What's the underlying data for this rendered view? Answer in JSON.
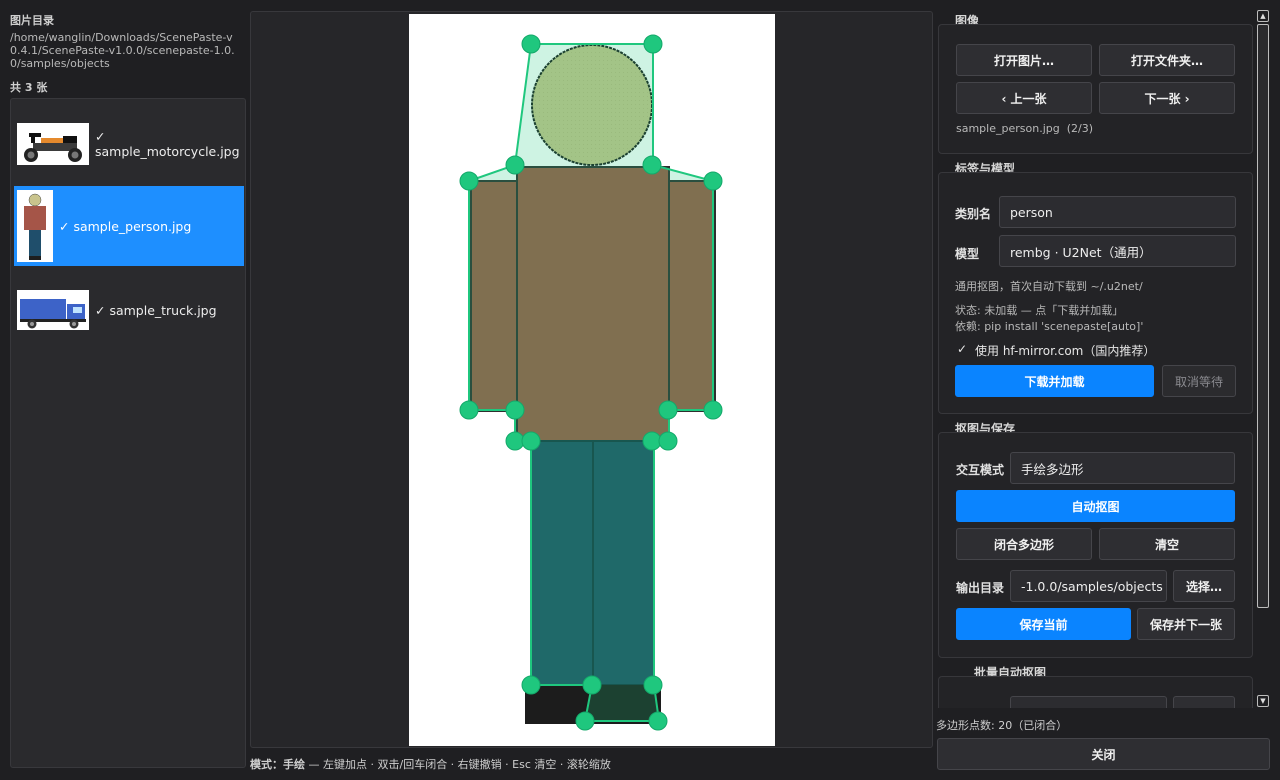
{
  "left": {
    "title": "图片目录",
    "path": "/home/wanglin/Downloads/ScenePaste-v0.4.1/ScenePaste-v1.0.0/scenepaste-1.0.0/samples/objects",
    "count": "共 3 张",
    "files": [
      {
        "name": "✓\nsample_motorcycle.jpg",
        "selected": false
      },
      {
        "name": "✓ sample_person.jpg",
        "selected": true
      },
      {
        "name": "✓ sample_truck.jpg",
        "selected": false
      }
    ]
  },
  "status_bar": {
    "mode": "模式：手绘",
    "hints": " — 左键加点 · 双击/回车闭合 · 右键撤销 · Esc 清空 · 滚轮缩放"
  },
  "right": {
    "image_group": {
      "title": "图像",
      "open_image": "打开图片…",
      "open_folder": "打开文件夹…",
      "prev": "‹ 上一张",
      "next": "下一张 ›",
      "current": "sample_person.jpg  (2/3)"
    },
    "label_group": {
      "title": "标签与模型",
      "class_label": "类别名",
      "class_value": "person",
      "model_label": "模型",
      "model_value": "rembg · U2Net（通用）",
      "model_desc": "通用抠图，首次自动下载到 ~/.u2net/",
      "state": "状态: 未加载 — 点「下载并加载」",
      "deps": "依赖: pip install 'scenepaste[auto]'",
      "mirror_check": "✓",
      "mirror": "使用 hf-mirror.com（国内推荐）",
      "download": "下载并加载",
      "cancel": "取消等待"
    },
    "cut_group": {
      "title": "抠图与保存",
      "mode_label": "交互模式",
      "mode_value": "手绘多边形",
      "auto_cut": "自动抠图",
      "close_poly": "闭合多边形",
      "clear": "清空",
      "out_label": "输出目录",
      "out_value": "-1.0.0/samples/objects",
      "choose": "选择…",
      "save": "保存当前",
      "save_next": "保存并下一张"
    },
    "batch_group": {
      "title": "批量自动抠图"
    },
    "points_info": "多边形点数: 20（已闭合）",
    "close": "关闭"
  },
  "colors": {
    "accent": "#0a84ff",
    "polygon": "#1fc77e",
    "selection": "#1e8fff"
  }
}
